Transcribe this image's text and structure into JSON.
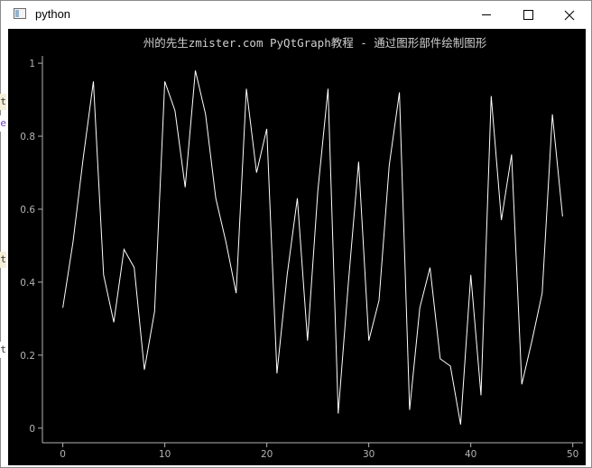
{
  "window": {
    "title": "python",
    "icon": "python-window-icon"
  },
  "chart_data": {
    "type": "line",
    "title": "州的先生zmister.com PyQtGraph教程 - 通过图形部件绘制图形",
    "xlabel": "",
    "ylabel": "",
    "xlim": [
      -2,
      51
    ],
    "ylim": [
      -0.04,
      1.02
    ],
    "xticks": [
      0,
      10,
      20,
      30,
      40,
      50
    ],
    "yticks": [
      0,
      0.2,
      0.4,
      0.6,
      0.8,
      1
    ],
    "xtick_labels": [
      "0",
      "10",
      "20",
      "30",
      "40",
      "50"
    ],
    "ytick_labels": [
      "0",
      "0.2",
      "0.4",
      "0.6",
      "0.8",
      "1"
    ],
    "grid": false,
    "background": "#000000",
    "line_color": "#ffffff",
    "axis_color": "#b4b4b4",
    "series": [
      {
        "x": [
          0,
          1,
          2,
          3,
          4,
          5,
          6,
          7,
          8,
          9,
          10,
          11,
          12,
          13,
          14,
          15,
          16,
          17,
          18,
          19,
          20,
          21,
          22,
          23,
          24,
          25,
          26,
          27,
          28,
          29,
          30,
          31,
          32,
          33,
          34,
          35,
          36,
          37,
          38,
          39,
          40,
          41,
          42,
          43,
          44,
          45,
          46,
          47,
          48,
          49
        ],
        "values": [
          0.33,
          0.51,
          0.74,
          0.95,
          0.42,
          0.29,
          0.49,
          0.44,
          0.16,
          0.32,
          0.95,
          0.87,
          0.66,
          0.98,
          0.86,
          0.63,
          0.51,
          0.37,
          0.93,
          0.7,
          0.82,
          0.15,
          0.42,
          0.63,
          0.24,
          0.65,
          0.93,
          0.04,
          0.4,
          0.73,
          0.24,
          0.35,
          0.72,
          0.92,
          0.05,
          0.33,
          0.44,
          0.19,
          0.17,
          0.01,
          0.42,
          0.09,
          0.91,
          0.57,
          0.75,
          0.12,
          0.24,
          0.37,
          0.86,
          0.58
        ]
      }
    ]
  },
  "edge_fragments": [
    "t",
    "e",
    "t",
    "t"
  ]
}
